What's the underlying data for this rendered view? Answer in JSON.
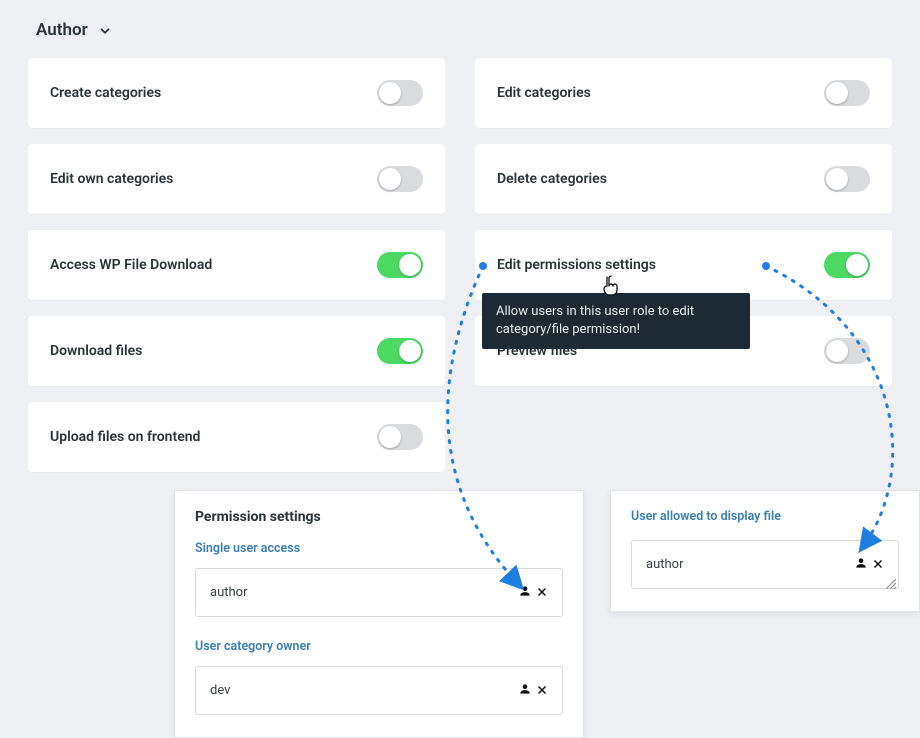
{
  "role": {
    "label": "Author"
  },
  "permissions": {
    "left": [
      {
        "label": "Create categories",
        "on": false
      },
      {
        "label": "Edit own categories",
        "on": false
      },
      {
        "label": "Access WP File Download",
        "on": true
      },
      {
        "label": "Download files",
        "on": true
      },
      {
        "label": "Upload files on frontend",
        "on": false
      }
    ],
    "right": [
      {
        "label": "Edit categories",
        "on": false
      },
      {
        "label": "Delete categories",
        "on": false
      },
      {
        "label": "Edit permissions settings",
        "on": true
      },
      {
        "label": "Preview files",
        "on": false
      }
    ]
  },
  "tooltip": {
    "text": "Allow users in this user role to edit category/file permission!"
  },
  "panel_left": {
    "title": "Permission settings",
    "single_user_access_label": "Single user access",
    "single_user_access_value": "author",
    "category_owner_label": "User category owner",
    "category_owner_value": "dev"
  },
  "panel_right": {
    "title": "User allowed to display file",
    "value": "author"
  }
}
